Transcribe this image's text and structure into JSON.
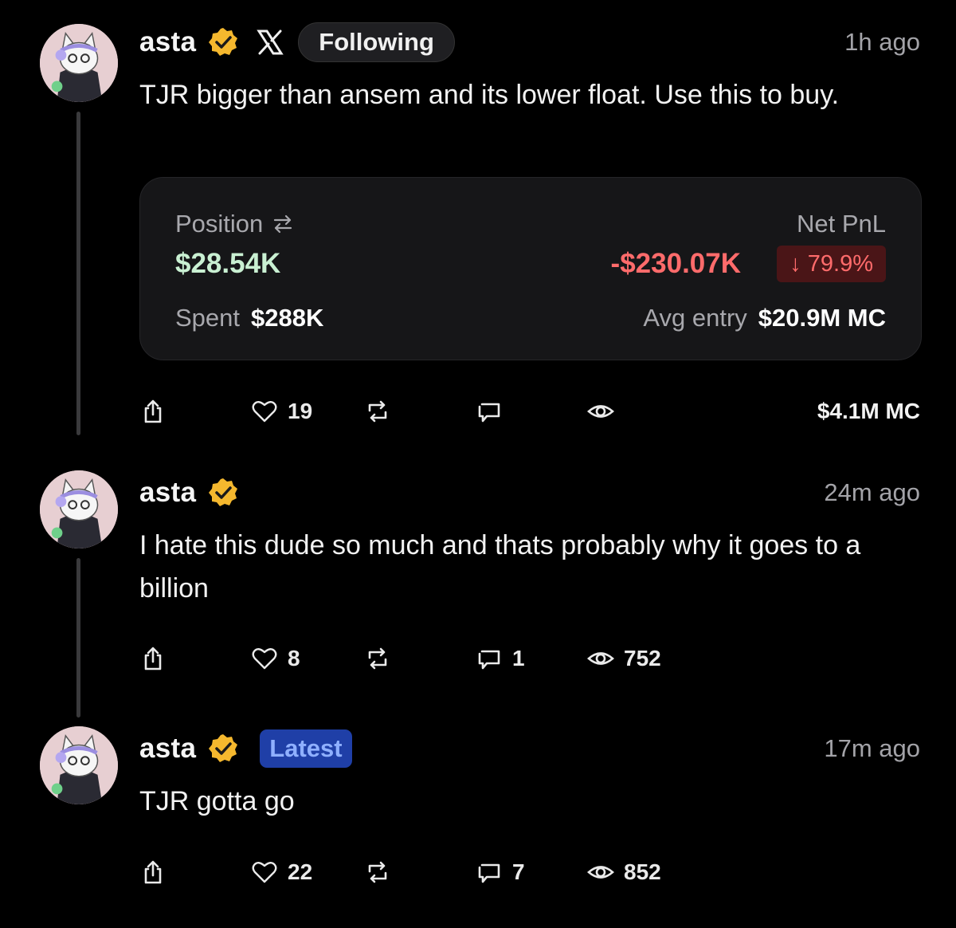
{
  "posts": [
    {
      "author": "asta",
      "tag": "Following",
      "time": "1h ago",
      "text": "TJR bigger than ansem and its lower float. Use this to buy.",
      "card": {
        "position_label": "Position",
        "position_value": "$28.54K",
        "spent_label": "Spent",
        "spent_value": "$288K",
        "pnl_label": "Net PnL",
        "pnl_value": "-$230.07K",
        "pnl_pct": "↓ 79.9%",
        "entry_label": "Avg entry",
        "entry_value": "$20.9M MC"
      },
      "likes": "19",
      "replies": "",
      "views": "",
      "market_cap": "$4.1M MC"
    },
    {
      "author": "asta",
      "time": "24m ago",
      "text": "I hate this dude so much and thats probably why it goes to a billion",
      "likes": "8",
      "replies": "1",
      "views": "752"
    },
    {
      "author": "asta",
      "tag": "Latest",
      "time": "17m ago",
      "text": "TJR gotta go",
      "likes": "22",
      "replies": "7",
      "views": "852"
    }
  ],
  "icons": {
    "verified": "verified-badge-icon",
    "platform": "x-logo-icon",
    "swap": "swap-arrows-icon",
    "share": "share-icon",
    "like": "heart-icon",
    "repost": "repost-icon",
    "reply": "reply-icon",
    "views": "eye-icon"
  },
  "colors": {
    "background": "#000000",
    "verified": "#f5b82e",
    "positive": "#c9f0d2",
    "negative": "#ff6b6b",
    "latest_pill": "#1f3fa7"
  }
}
